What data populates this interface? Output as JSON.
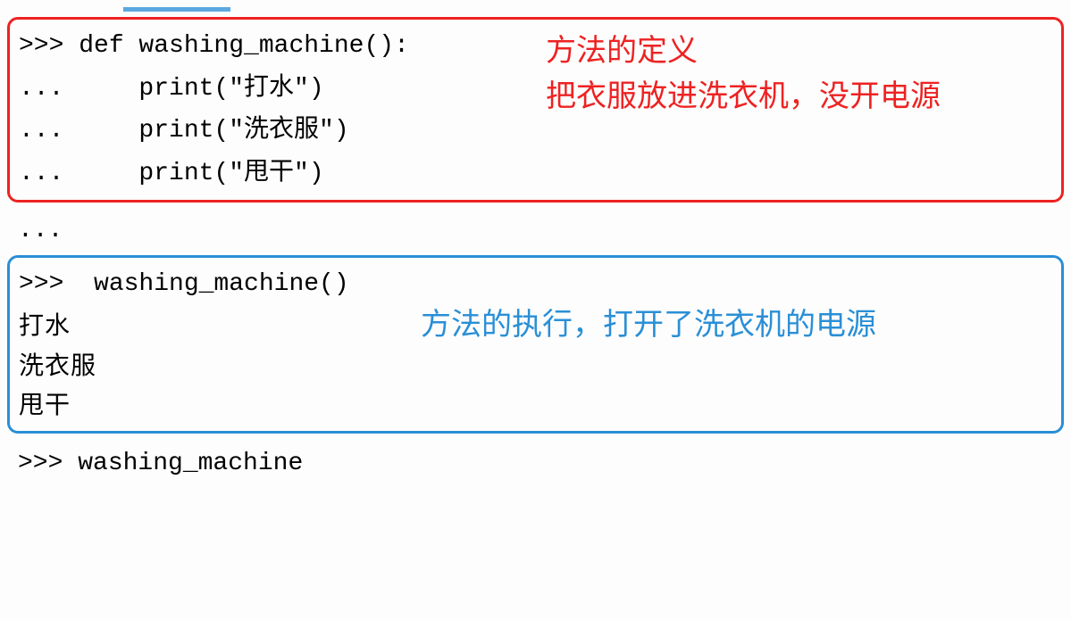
{
  "section1": {
    "lines": [
      ">>> def washing_machine():",
      "...     print(\"打水\")",
      "...     print(\"洗衣服\")",
      "...     print(\"甩干\")"
    ],
    "annotation": "方法的定义\n把衣服放进洗衣机，没开电源"
  },
  "between": "...",
  "section2": {
    "call_line": ">>>  washing_machine()",
    "outputs": [
      "打水",
      "洗衣服",
      "甩干"
    ],
    "annotation": "方法的执行，打开了洗衣机的电源"
  },
  "bottom": ">>> washing_machine"
}
